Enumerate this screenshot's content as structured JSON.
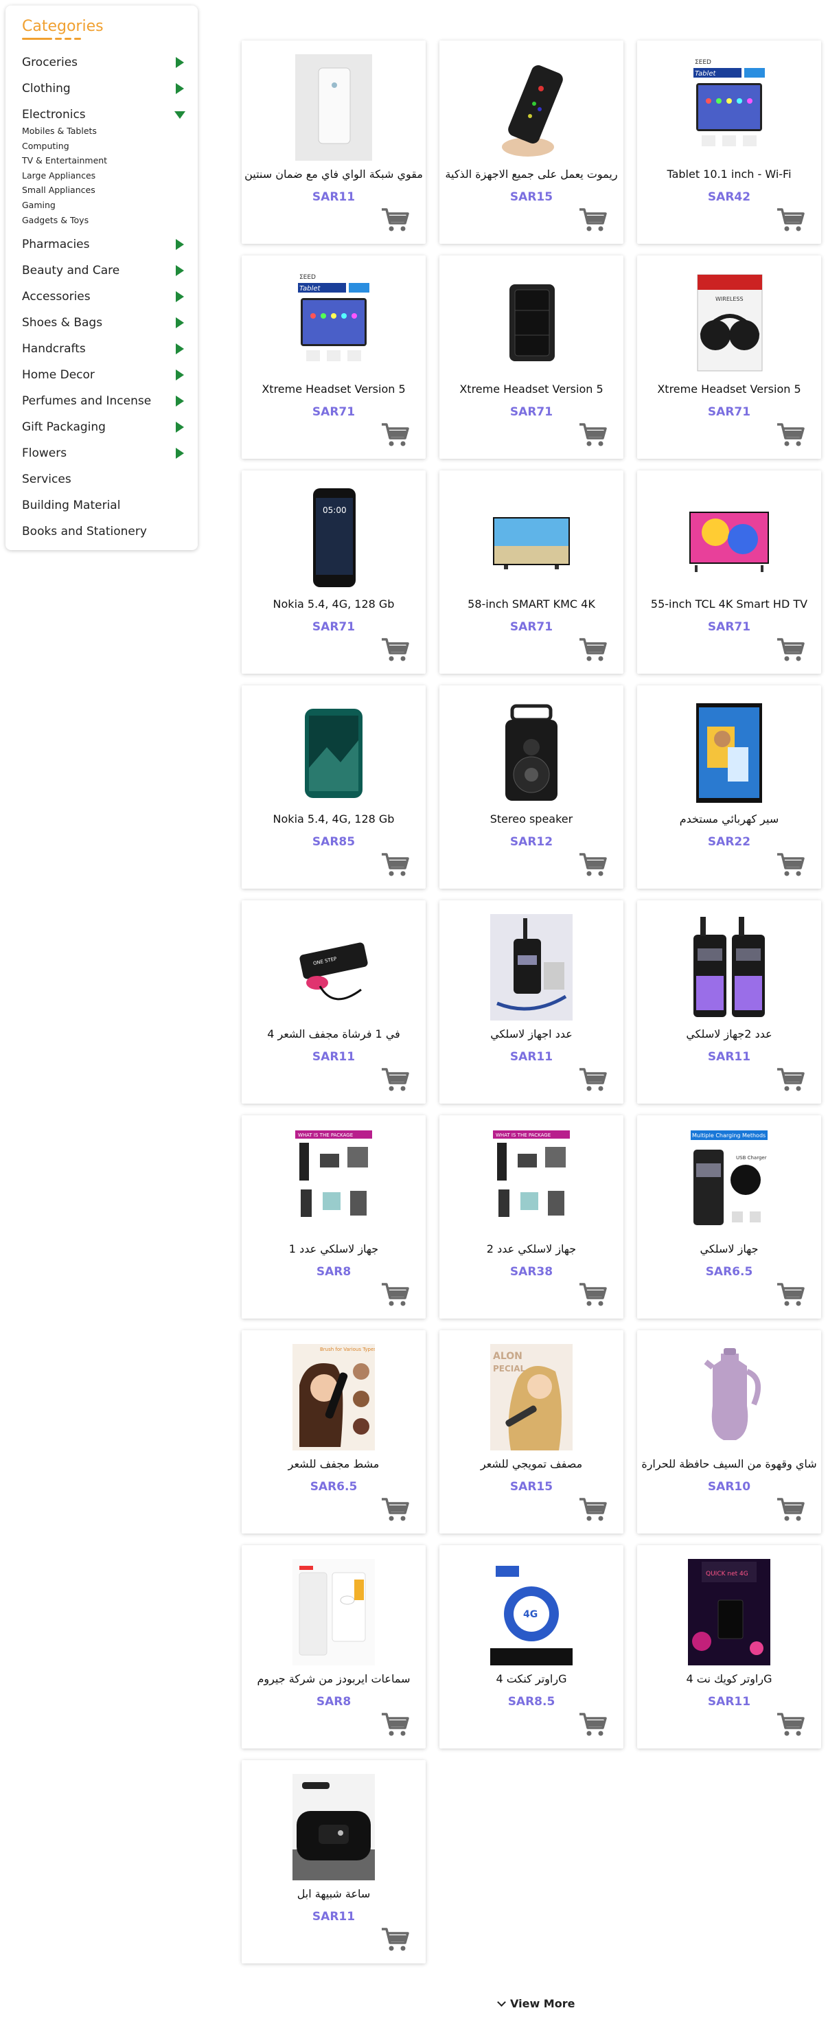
{
  "sidebar": {
    "title": "Categories",
    "categories": [
      {
        "label": "Groceries",
        "arrow": "right"
      },
      {
        "label": "Clothing",
        "arrow": "right"
      },
      {
        "label": "Electronics",
        "arrow": "down",
        "expanded": true,
        "children": [
          "Mobiles & Tablets",
          "Computing",
          "TV & Entertainment",
          "Large Appliances",
          "Small Appliances",
          "Gaming",
          "Gadgets & Toys"
        ]
      },
      {
        "label": "Pharmacies",
        "arrow": "right"
      },
      {
        "label": "Beauty and Care",
        "arrow": "right"
      },
      {
        "label": "Accessories",
        "arrow": "right"
      },
      {
        "label": "Shoes & Bags",
        "arrow": "right"
      },
      {
        "label": "Handcrafts",
        "arrow": "right"
      },
      {
        "label": "Home Decor",
        "arrow": "right"
      },
      {
        "label": "Perfumes and Incense",
        "arrow": "right"
      },
      {
        "label": "Gift Packaging",
        "arrow": "right"
      },
      {
        "label": "Flowers",
        "arrow": "right"
      },
      {
        "label": "Services",
        "arrow": "none"
      },
      {
        "label": "Building Material",
        "arrow": "none"
      },
      {
        "label": "Books and Stationery",
        "arrow": "none"
      }
    ]
  },
  "products": [
    {
      "name": "مقوي شبكة الواي فاي مع ضمان سنتين",
      "price": "SAR11",
      "image": "wifi-extender"
    },
    {
      "name": "ريموت يعمل على جميع الاجهزة الذكية",
      "price": "SAR15",
      "image": "remote"
    },
    {
      "name": "Tablet 10.1 inch - Wi-Fi",
      "price": "SAR42",
      "image": "tablet"
    },
    {
      "name": "Xtreme Headset Version 5",
      "price": "SAR71",
      "image": "tablet"
    },
    {
      "name": "Xtreme Headset Version 5",
      "price": "SAR71",
      "image": "powerbank"
    },
    {
      "name": "Xtreme Headset Version 5",
      "price": "SAR71",
      "image": "headset"
    },
    {
      "name": "Nokia 5.4, 4G, 128 Gb",
      "price": "SAR71",
      "image": "phone-black"
    },
    {
      "name": "58-inch SMART KMC 4K",
      "price": "SAR71",
      "image": "tv-blue"
    },
    {
      "name": "55-inch TCL 4K Smart HD TV",
      "price": "SAR71",
      "image": "tv-colorful"
    },
    {
      "name": "Nokia 5.4, 4G, 128 Gb",
      "price": "SAR85",
      "image": "phone-green"
    },
    {
      "name": "Stereo speaker",
      "price": "SAR12",
      "image": "speaker"
    },
    {
      "name": "سير كهربائي مستخدم",
      "price": "SAR22",
      "image": "photo"
    },
    {
      "name": "4 في 1 فرشاة مجفف الشعر",
      "price": "SAR11",
      "image": "hair-dryer"
    },
    {
      "name": "عدد اجهاز لاسلكي",
      "price": "SAR11",
      "image": "radio-single"
    },
    {
      "name": "عدد 2جهاز لاسلكي",
      "price": "SAR11",
      "image": "radio-pair"
    },
    {
      "name": "جهاز لاسلكي عدد 1",
      "price": "SAR8",
      "image": "package"
    },
    {
      "name": "جهاز لاسلكي عدد 2",
      "price": "SAR38",
      "image": "package"
    },
    {
      "name": "جهاز لاسلكي",
      "price": "SAR6.5",
      "image": "radio-charging"
    },
    {
      "name": "مشط مجفف للشعر",
      "price": "SAR6.5",
      "image": "woman-hair"
    },
    {
      "name": "مصفف تمويجي للشعر",
      "price": "SAR15",
      "image": "woman-blonde"
    },
    {
      "name": "شاي وقهوة من السيف حافظة للحرارة",
      "price": "SAR10",
      "image": "thermos"
    },
    {
      "name": "سماعات ايربودز من شركة جيروم",
      "price": "SAR8",
      "image": "earbuds"
    },
    {
      "name": "راوتر كنكت 4G",
      "price": "SAR8.5",
      "image": "router-blue"
    },
    {
      "name": "راوتر كويك نت 4G",
      "price": "SAR11",
      "image": "router-dark"
    },
    {
      "name": "ساعة شبيهة ابل",
      "price": "SAR11",
      "image": "watch"
    }
  ],
  "view_more": "View More",
  "colors": {
    "accent": "#f0a030",
    "price": "#7b6fe0",
    "arrow": "#1f8a3a",
    "cart": "#666666"
  }
}
